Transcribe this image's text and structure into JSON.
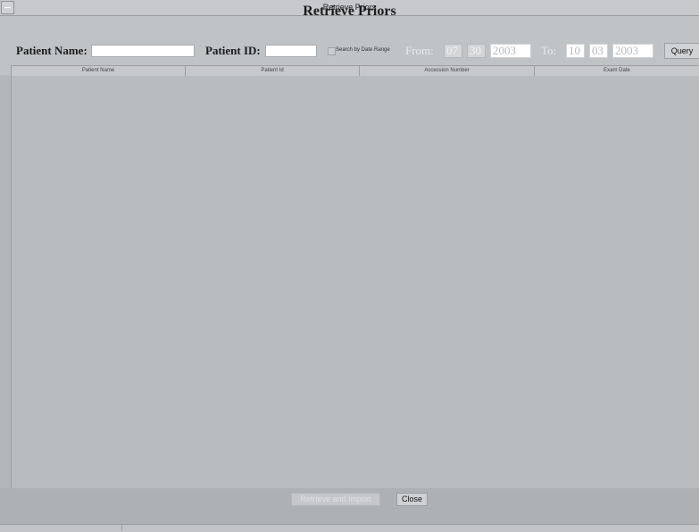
{
  "window": {
    "title": "Retrieve Priors"
  },
  "header": {
    "title": "Retrieve Priors",
    "patient_name_label": "Patient Name:",
    "patient_name_value": "",
    "patient_id_label": "Patient ID:",
    "patient_id_value": "",
    "date_range_checkbox_label": "Search by Date Range",
    "from_label": "From:",
    "from_month": "07",
    "from_day": "30",
    "from_year": "2003",
    "to_label": "To:",
    "to_month": "10",
    "to_day": "03",
    "to_year": "2003",
    "query_label": "Query"
  },
  "table": {
    "columns": [
      "Patient Name",
      "Patient Id",
      "Accession Number",
      "Exam Date"
    ],
    "rows": []
  },
  "footer": {
    "retrieve_label": "Retrieve and Import",
    "close_label": "Close"
  }
}
